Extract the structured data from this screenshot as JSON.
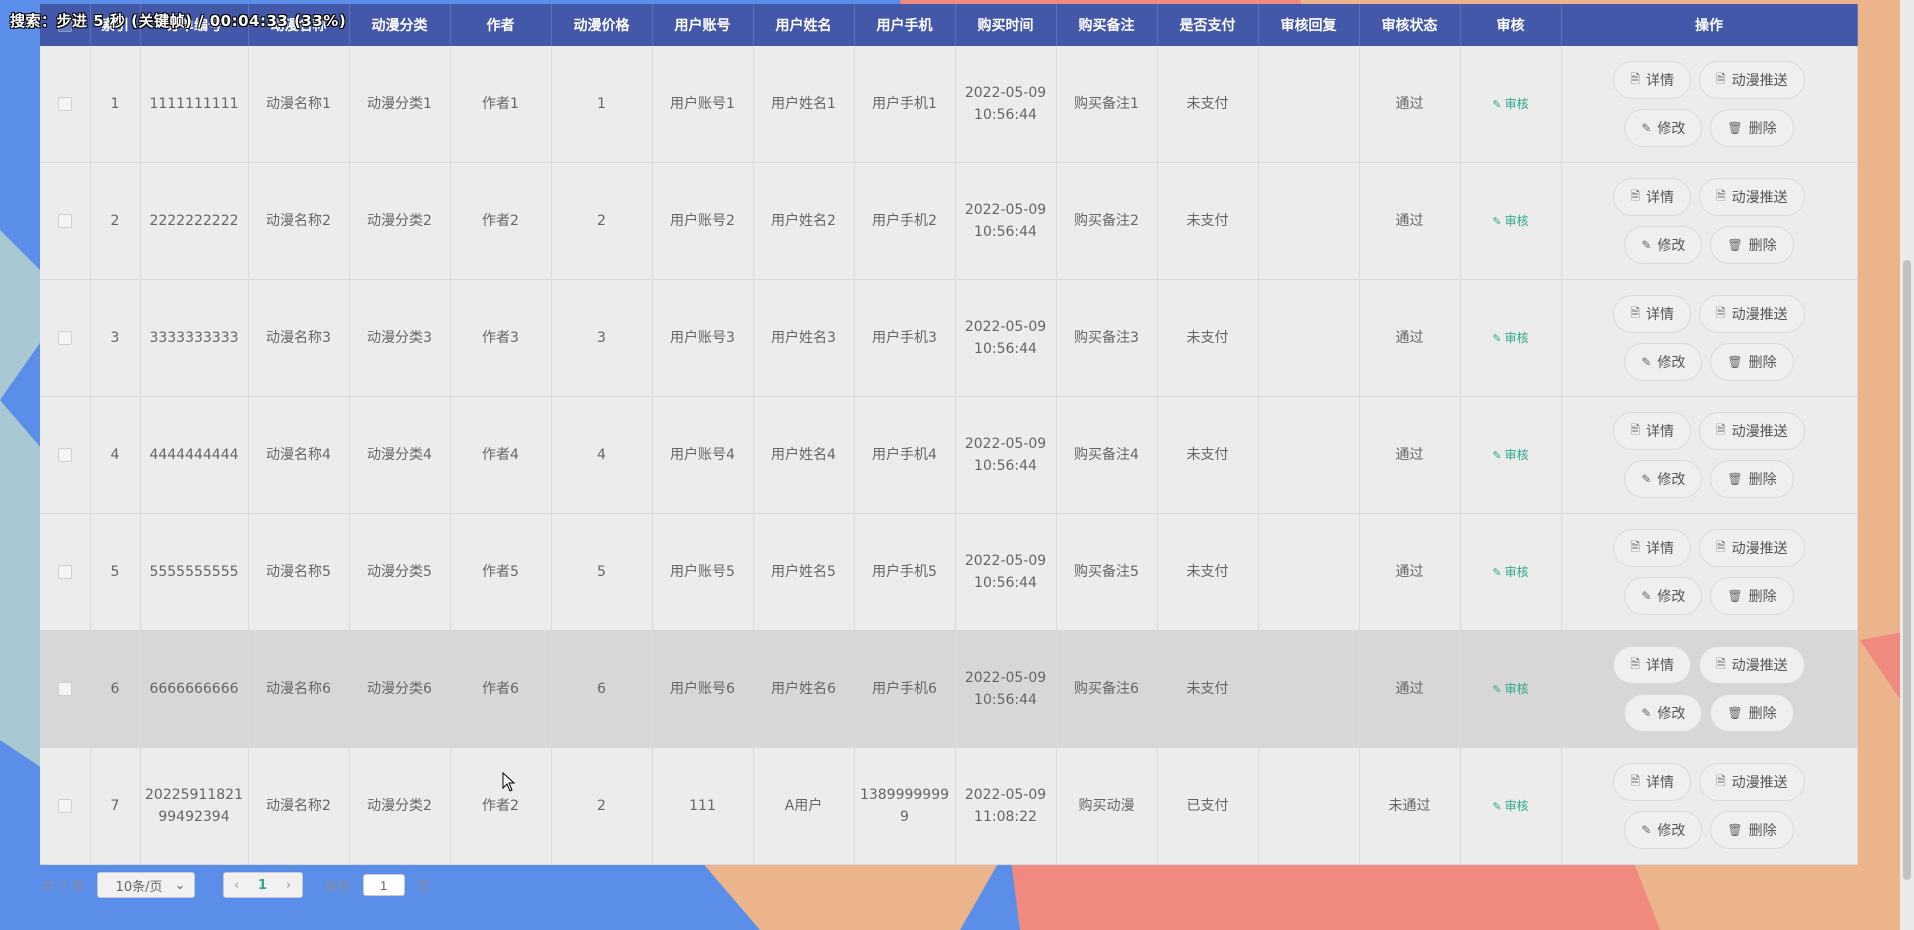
{
  "overlay": {
    "text": "搜索：步进 5 秒 (关键帧) / 00:04:33 (33%)"
  },
  "table": {
    "headers": [
      "",
      "索引",
      "订单编号",
      "动漫名称",
      "动漫分类",
      "作者",
      "动漫价格",
      "用户账号",
      "用户姓名",
      "用户手机",
      "购买时间",
      "购买备注",
      "是否支付",
      "审核回复",
      "审核状态",
      "审核",
      "操作"
    ],
    "audit_label": "审核",
    "buttons": {
      "detail": "详情",
      "push": "动漫推送",
      "edit": "修改",
      "delete": "删除"
    },
    "rows": [
      [
        "1",
        "1111111111",
        "动漫名称1",
        "动漫分类1",
        "作者1",
        "1",
        "用户账号1",
        "用户姓名1",
        "用户手机1",
        "2022-05-09 10:56:44",
        "购买备注1",
        "未支付",
        "",
        "通过"
      ],
      [
        "2",
        "2222222222",
        "动漫名称2",
        "动漫分类2",
        "作者2",
        "2",
        "用户账号2",
        "用户姓名2",
        "用户手机2",
        "2022-05-09 10:56:44",
        "购买备注2",
        "未支付",
        "",
        "通过"
      ],
      [
        "3",
        "3333333333",
        "动漫名称3",
        "动漫分类3",
        "作者3",
        "3",
        "用户账号3",
        "用户姓名3",
        "用户手机3",
        "2022-05-09 10:56:44",
        "购买备注3",
        "未支付",
        "",
        "通过"
      ],
      [
        "4",
        "4444444444",
        "动漫名称4",
        "动漫分类4",
        "作者4",
        "4",
        "用户账号4",
        "用户姓名4",
        "用户手机4",
        "2022-05-09 10:56:44",
        "购买备注4",
        "未支付",
        "",
        "通过"
      ],
      [
        "5",
        "5555555555",
        "动漫名称5",
        "动漫分类5",
        "作者5",
        "5",
        "用户账号5",
        "用户姓名5",
        "用户手机5",
        "2022-05-09 10:56:44",
        "购买备注5",
        "未支付",
        "",
        "通过"
      ],
      [
        "6",
        "6666666666",
        "动漫名称6",
        "动漫分类6",
        "作者6",
        "6",
        "用户账号6",
        "用户姓名6",
        "用户手机6",
        "2022-05-09 10:56:44",
        "购买备注6",
        "未支付",
        "",
        "通过"
      ],
      [
        "7",
        "2022591182199492394",
        "动漫名称2",
        "动漫分类2",
        "作者2",
        "2",
        "111",
        "A用户",
        "13899999999",
        "2022-05-09 11:08:22",
        "购买动漫",
        "已支付",
        "",
        "未通过"
      ]
    ],
    "hover_row": 5
  },
  "pagination": {
    "total": "共 7 条",
    "page_size": "10条/页",
    "current_page": "1",
    "goto_prefix": "前往",
    "goto_value": "1",
    "goto_suffix": "页"
  },
  "colors": {
    "header_bg": "#4358a8",
    "accent": "#2ea88b",
    "bg_blue": "#5b8ee8",
    "bg_orange": "#ecb48a",
    "bg_red": "#f08a7e",
    "bg_teal": "#a8c8d4"
  },
  "icons": [
    "document-icon",
    "edit-icon",
    "trash-icon",
    "chevron-down-icon",
    "chevron-left-icon",
    "chevron-right-icon",
    "cursor-icon"
  ]
}
